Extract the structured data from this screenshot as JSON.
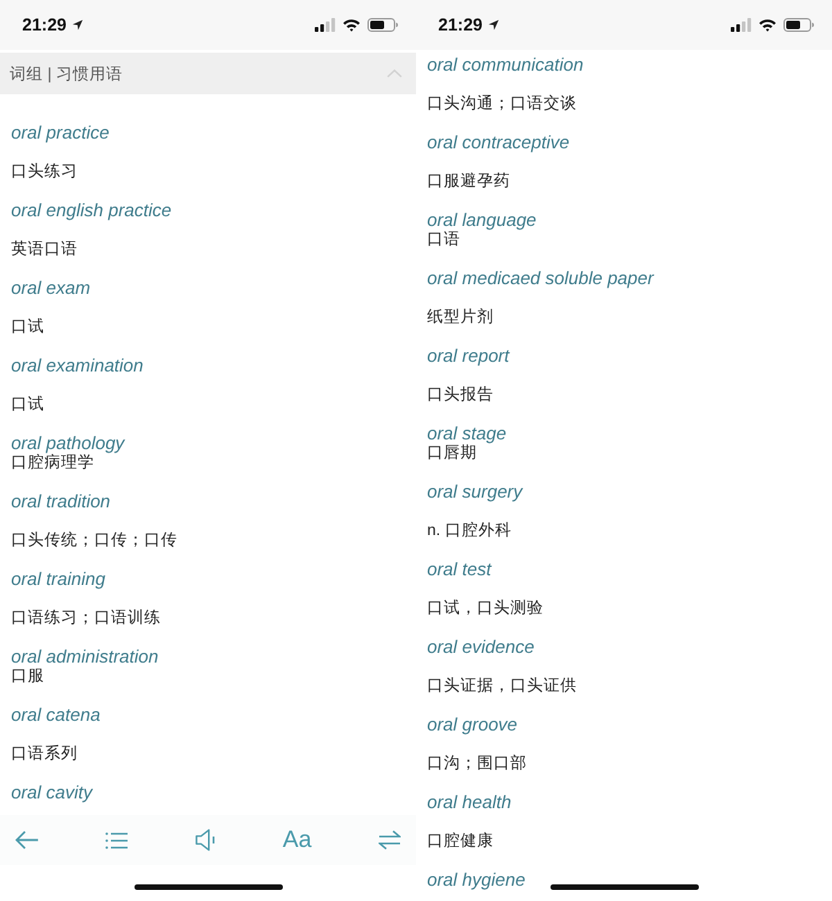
{
  "screens": [
    {
      "status_bar": {
        "time": "21:29"
      },
      "header": {
        "title": "词组 | 习惯用语",
        "expanded": true
      },
      "entries": [
        {
          "term": "oral practice",
          "meaning": "口头练习",
          "kind": "spaced"
        },
        {
          "term": "oral english practice",
          "meaning": "英语口语",
          "kind": "spaced"
        },
        {
          "term": "oral exam",
          "meaning": "口试",
          "kind": "spaced"
        },
        {
          "term": "oral examination",
          "meaning": "口试",
          "kind": "spaced"
        },
        {
          "term": "oral pathology",
          "meaning": "口腔病理学",
          "kind": "tight"
        },
        {
          "term": "oral tradition",
          "meaning": "口头传统；口传；口传",
          "kind": "spaced"
        },
        {
          "term": "oral training",
          "meaning": "口语练习；口语训练",
          "kind": "spaced"
        },
        {
          "term": "oral administration",
          "meaning": "口服",
          "kind": "tight"
        },
        {
          "term": "oral catena",
          "meaning": "口语系列",
          "kind": "spaced"
        },
        {
          "term": "oral cavity",
          "kind": "spaced"
        }
      ],
      "toolbar": {
        "font_button": "Aa"
      }
    },
    {
      "status_bar": {
        "time": "21:29"
      },
      "entries": [
        {
          "term": "oral communication",
          "meaning": "口头沟通；口语交谈",
          "kind": "spaced"
        },
        {
          "term": "oral contraceptive",
          "meaning": "口服避孕药",
          "kind": "spaced"
        },
        {
          "term": "oral language",
          "meaning": "口语",
          "kind": "tight"
        },
        {
          "term": "oral medicaed soluble paper",
          "meaning": "纸型片剂",
          "kind": "spaced"
        },
        {
          "term": "oral report",
          "meaning": "口头报告",
          "kind": "spaced"
        },
        {
          "term": "oral stage",
          "meaning": "口唇期",
          "kind": "tight"
        },
        {
          "term": "oral surgery",
          "meaning": "n. 口腔外科",
          "kind": "spaced"
        },
        {
          "term": "oral test",
          "meaning": "口试，口头测验",
          "kind": "spaced"
        },
        {
          "term": "oral evidence",
          "meaning": "口头证据，口头证供",
          "kind": "spaced"
        },
        {
          "term": "oral groove",
          "meaning": "口沟；围口部",
          "kind": "spaced"
        },
        {
          "term": "oral health",
          "meaning": "口腔健康",
          "kind": "spaced"
        },
        {
          "term": "oral hygiene",
          "kind": "spaced"
        }
      ]
    }
  ]
}
